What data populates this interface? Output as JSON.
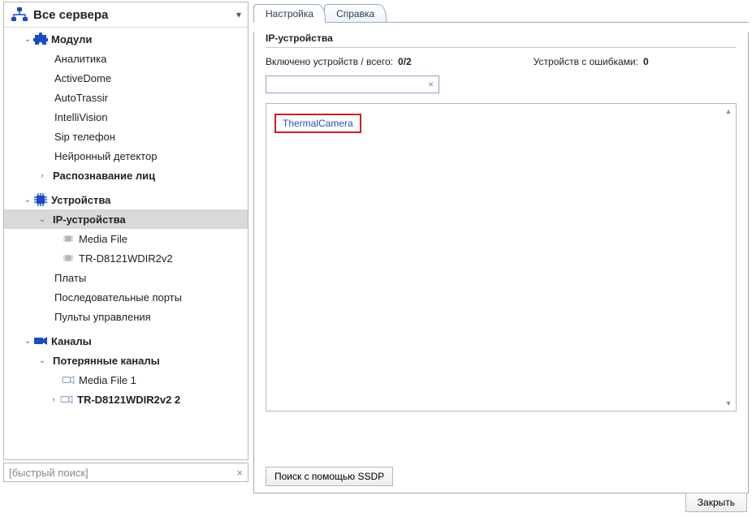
{
  "header": {
    "all_servers": "Все сервера"
  },
  "tree": {
    "modules": {
      "label": "Модули",
      "items": [
        "Аналитика",
        "ActiveDome",
        "AutoTrassir",
        "IntelliVision",
        "Sip телефон",
        "Нейронный детектор"
      ],
      "face_recognition": "Распознавание лиц"
    },
    "devices": {
      "label": "Устройства",
      "ip_devices": "IP-устройства",
      "ip_children": [
        "Media File",
        "TR-D8121WDIR2v2"
      ],
      "others": [
        "Платы",
        "Последовательные порты",
        "Пульты управления"
      ]
    },
    "channels": {
      "label": "Каналы",
      "lost": "Потерянные каналы",
      "lost_children": [
        "Media File 1",
        "TR-D8121WDIR2v2 2"
      ]
    }
  },
  "quick_search": {
    "placeholder": "[быстрый поиск]",
    "clear": "×"
  },
  "tabs": {
    "settings": "Настройка",
    "help": "Справка"
  },
  "panel": {
    "section_title": "IP-устройства",
    "enabled_label": "Включено устройств / всего:",
    "enabled_value": "0/2",
    "errors_label": "Устройств с ошибками:",
    "errors_value": "0",
    "filter_clear": "×",
    "device_name": "ThermalCamera",
    "ssdp_button": "Поиск с помощью SSDP"
  },
  "footer": {
    "close": "Закрыть"
  }
}
